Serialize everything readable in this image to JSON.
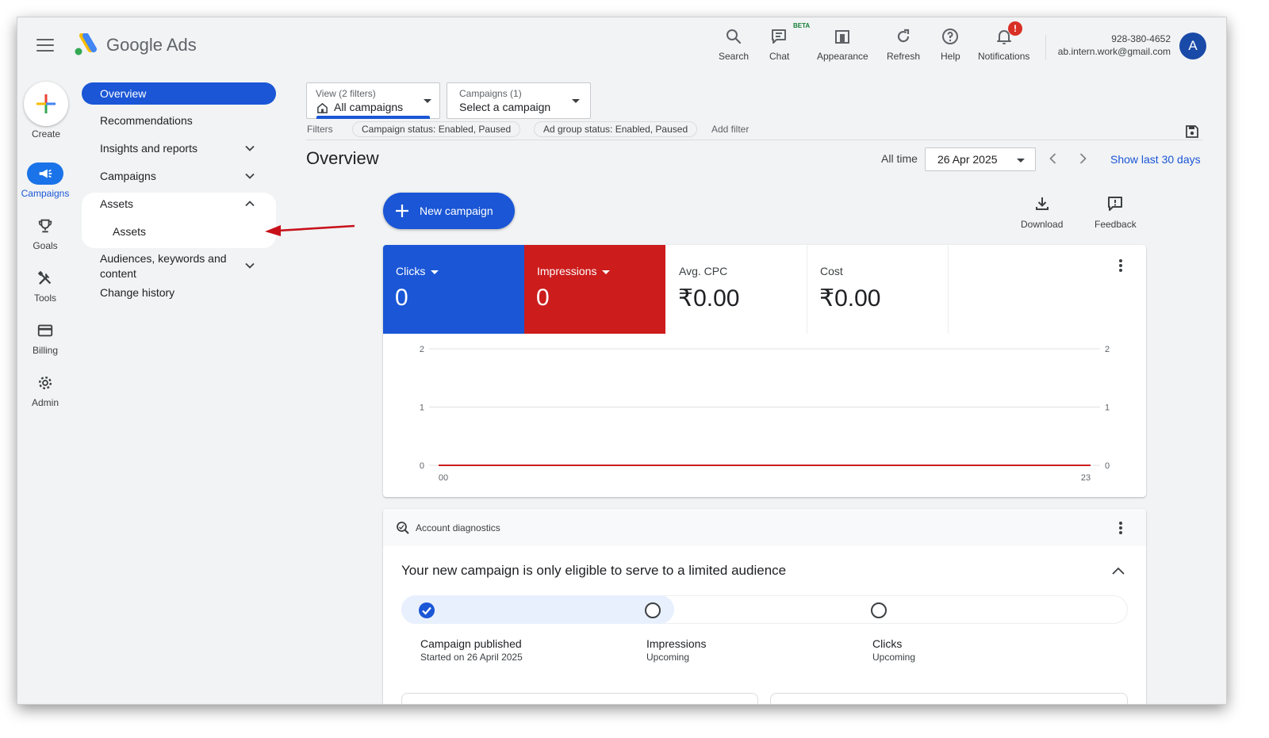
{
  "header": {
    "brand": "Google Ads",
    "actions": [
      {
        "label": "Search",
        "icon": "search-icon"
      },
      {
        "label": "Chat",
        "icon": "chat-icon",
        "badge": "BETA"
      },
      {
        "label": "Appearance",
        "icon": "appearance-icon"
      },
      {
        "label": "Refresh",
        "icon": "refresh-icon"
      },
      {
        "label": "Help",
        "icon": "help-icon"
      },
      {
        "label": "Notifications",
        "icon": "bell-icon",
        "alert": "!"
      }
    ],
    "account": {
      "phone": "928-380-4652",
      "email": "ab.intern.work@gmail.com",
      "avatar_letter": "A"
    }
  },
  "rail": {
    "create": "Create",
    "items": [
      {
        "label": "Campaigns",
        "icon": "megaphone-icon",
        "active": true
      },
      {
        "label": "Goals",
        "icon": "trophy-icon"
      },
      {
        "label": "Tools",
        "icon": "tools-icon"
      },
      {
        "label": "Billing",
        "icon": "credit-card-icon"
      },
      {
        "label": "Admin",
        "icon": "gear-icon"
      }
    ]
  },
  "nav": {
    "overview": "Overview",
    "recommendations": "Recommendations",
    "insights": "Insights and reports",
    "campaigns": "Campaigns",
    "assets": "Assets",
    "assets_sub": "Assets",
    "audiences_line1": "Audiences, keywords and",
    "audiences_line2": "content",
    "change_history": "Change history"
  },
  "filters": {
    "view_small": "View (2 filters)",
    "view_value": "All campaigns",
    "campaigns_small": "Campaigns (1)",
    "campaigns_value": "Select a campaign",
    "label": "Filters",
    "chips": [
      "Campaign status: Enabled, Paused",
      "Ad group status: Enabled, Paused"
    ],
    "add_filter": "Add filter"
  },
  "page": {
    "title": "Overview",
    "range_label": "All time",
    "date": "26 Apr 2025",
    "show_last": "Show last 30 days",
    "new_campaign": "New campaign",
    "download": "Download",
    "feedback": "Feedback"
  },
  "metrics": [
    {
      "name": "Clicks",
      "value": "0",
      "color": "#1a56d6"
    },
    {
      "name": "Impressions",
      "value": "0",
      "color": "#cc1c1c"
    },
    {
      "name": "Avg. CPC",
      "value": "₹0.00"
    },
    {
      "name": "Cost",
      "value": "₹0.00"
    }
  ],
  "chart_data": {
    "type": "line",
    "x_ticks": [
      "00",
      "23"
    ],
    "y_ticks_left": [
      "2",
      "1",
      "0"
    ],
    "y_ticks_right": [
      "2",
      "1",
      "0"
    ],
    "ylim": [
      0,
      2
    ],
    "series": [
      {
        "values": [
          0,
          0
        ],
        "color": "#cc1c1c"
      },
      {
        "values": [
          0,
          0
        ],
        "color": "#1a56d6"
      }
    ],
    "grid": true
  },
  "diagnostics": {
    "title": "Account diagnostics",
    "message": "Your new campaign is only eligible to serve to a limited audience",
    "progress_fraction": 0.33,
    "steps": [
      {
        "name": "Campaign published",
        "sub": "Started on 26 April 2025",
        "done": true
      },
      {
        "name": "Impressions",
        "sub": "Upcoming",
        "done": false
      },
      {
        "name": "Clicks",
        "sub": "Upcoming",
        "done": false
      }
    ]
  }
}
